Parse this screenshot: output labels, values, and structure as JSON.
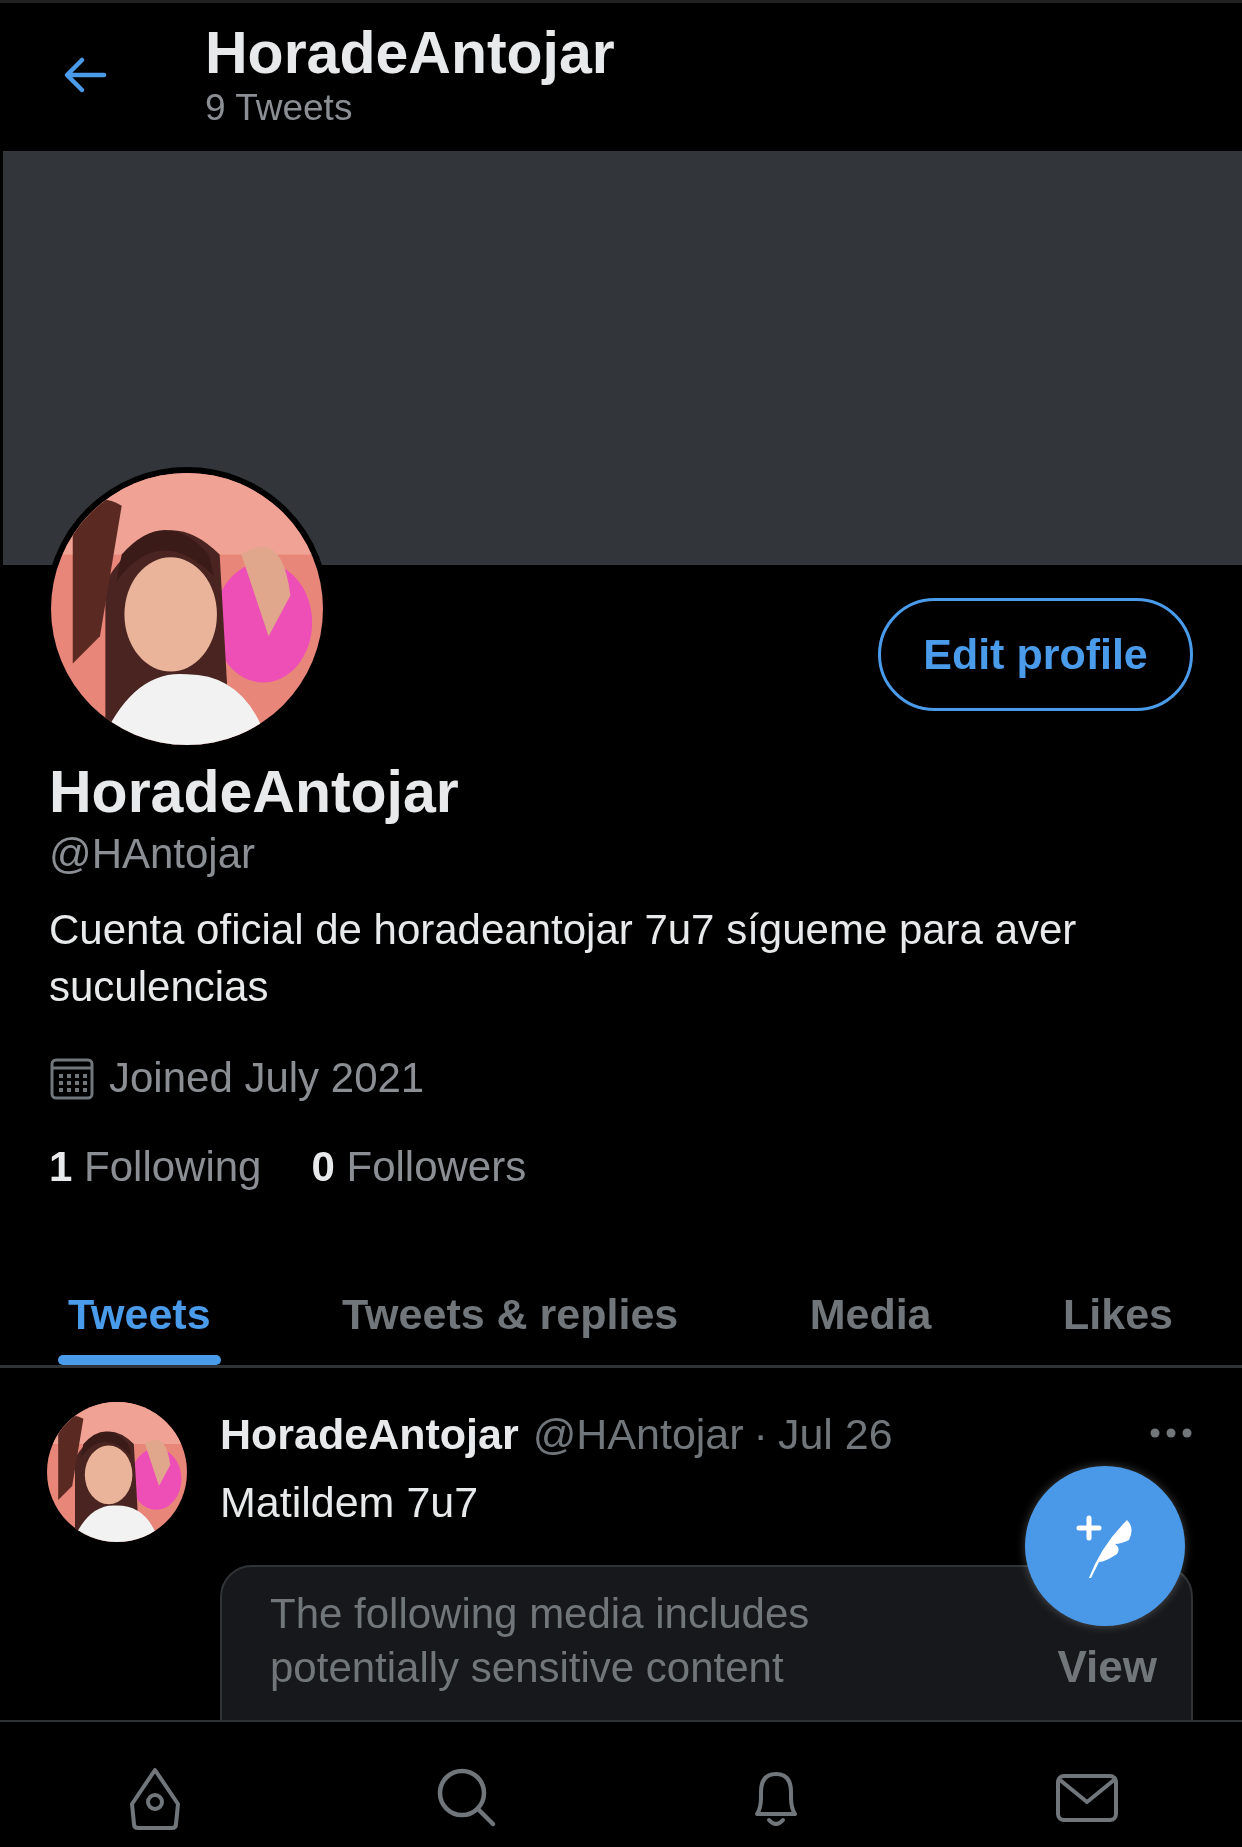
{
  "header": {
    "title": "HoradeAntojar",
    "subtitle": "9 Tweets"
  },
  "profile": {
    "name": "HoradeAntojar",
    "handle": "@HAntojar",
    "bio": "Cuenta oficial de horadeantojar 7u7 sígueme para aver suculencias",
    "joined": "Joined July 2021",
    "following_count": "1",
    "following_label": "Following",
    "followers_count": "0",
    "followers_label": "Followers"
  },
  "edit_button": "Edit profile",
  "tabs": [
    {
      "label": "Tweets",
      "selected": true
    },
    {
      "label": "Tweets & replies",
      "selected": false
    },
    {
      "label": "Media",
      "selected": false
    },
    {
      "label": "Likes",
      "selected": false
    }
  ],
  "tweets": [
    {
      "name": "HoradeAntojar",
      "handle": "@HAntojar",
      "separator": "·",
      "date": "Jul 26",
      "text": "Matildem 7u7",
      "media_notice": "The following media includes potentially sensitive content",
      "media_action": "View"
    }
  ],
  "bottom_nav": [
    {
      "kind": "home"
    },
    {
      "kind": "search"
    },
    {
      "kind": "notifications"
    },
    {
      "kind": "messages"
    }
  ]
}
